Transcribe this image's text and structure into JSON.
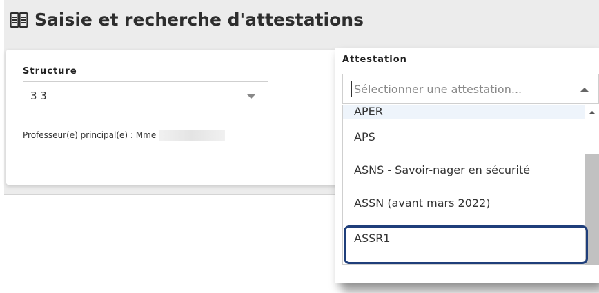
{
  "page": {
    "title": "Saisie et recherche d'attestations",
    "title_icon": "open-book-icon"
  },
  "structure": {
    "label": "Structure",
    "value": "3 3",
    "professor_label": "Professeur(e) principal(e) : Mme"
  },
  "attestation": {
    "label": "Attestation",
    "placeholder": "Sélectionner une attestation...",
    "options": [
      "APER",
      "APS",
      "ASNS - Savoir-nager en sécurité",
      "ASSN (avant mars 2022)",
      "ASSR1"
    ],
    "highlighted_option": "APER",
    "emphasized_option": "ASSR1"
  },
  "colors": {
    "page_background": "#ececec",
    "highlight_background": "#eef4fb",
    "emphasis_border": "#1f3e7a",
    "scrollbar_thumb": "#c1c1c1"
  }
}
